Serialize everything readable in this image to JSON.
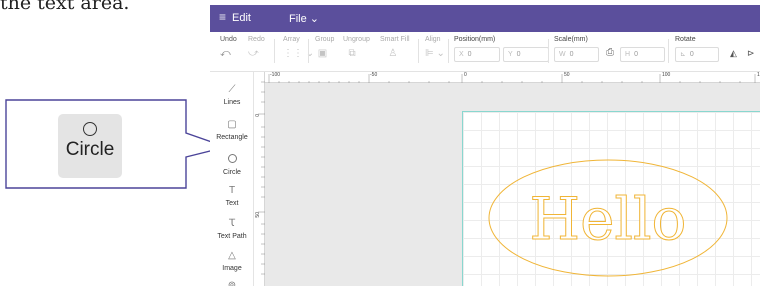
{
  "caption_text": "the text area.",
  "callout": {
    "label": "Circle",
    "icon": "circle-icon"
  },
  "topbar": {
    "menu_icon": "≡",
    "edit_label": "Edit",
    "file_label": "File ⌄"
  },
  "toolbar": {
    "undo": {
      "label": "Undo",
      "icon": "undo-icon"
    },
    "redo": {
      "label": "Redo",
      "icon": "redo-icon"
    },
    "array": {
      "label": "Array",
      "icon": "array-icon"
    },
    "group": {
      "label": "Group",
      "icon": "group-icon"
    },
    "ungroup": {
      "label": "Ungroup",
      "icon": "ungroup-icon"
    },
    "smart_fill": {
      "label": "Smart Fill",
      "icon": "smart-fill-icon"
    },
    "align": {
      "label": "Align",
      "icon": "align-icon"
    },
    "position": {
      "label": "Position(mm)",
      "x_prefix": "X",
      "x_value": "0",
      "y_prefix": "Y",
      "y_value": "0"
    },
    "scale": {
      "label": "Scale(mm)",
      "w_prefix": "W",
      "w_value": "0",
      "h_prefix": "H",
      "h_value": "0"
    },
    "rotate": {
      "label": "Rotate",
      "value": "0"
    }
  },
  "sidebar": {
    "items": [
      {
        "label": "Lines",
        "icon": "line-icon"
      },
      {
        "label": "Rectangle",
        "icon": "rectangle-icon"
      },
      {
        "label": "Circle",
        "icon": "circle-icon"
      },
      {
        "label": "Text",
        "icon": "text-icon"
      },
      {
        "label": "Text Path",
        "icon": "text-path-icon"
      },
      {
        "label": "Image",
        "icon": "image-icon"
      }
    ]
  },
  "rulers": {
    "h_labels": [
      "-100",
      "-50",
      "0",
      "50",
      "100",
      "1"
    ],
    "v_labels": [
      "0",
      "50"
    ]
  },
  "canvas": {
    "text": "Hello",
    "stroke_color": "#f0b537",
    "artboard_border": "#89d7cf"
  },
  "colors": {
    "topbar": "#5b4f9c",
    "callout_border": "#4b4499"
  }
}
